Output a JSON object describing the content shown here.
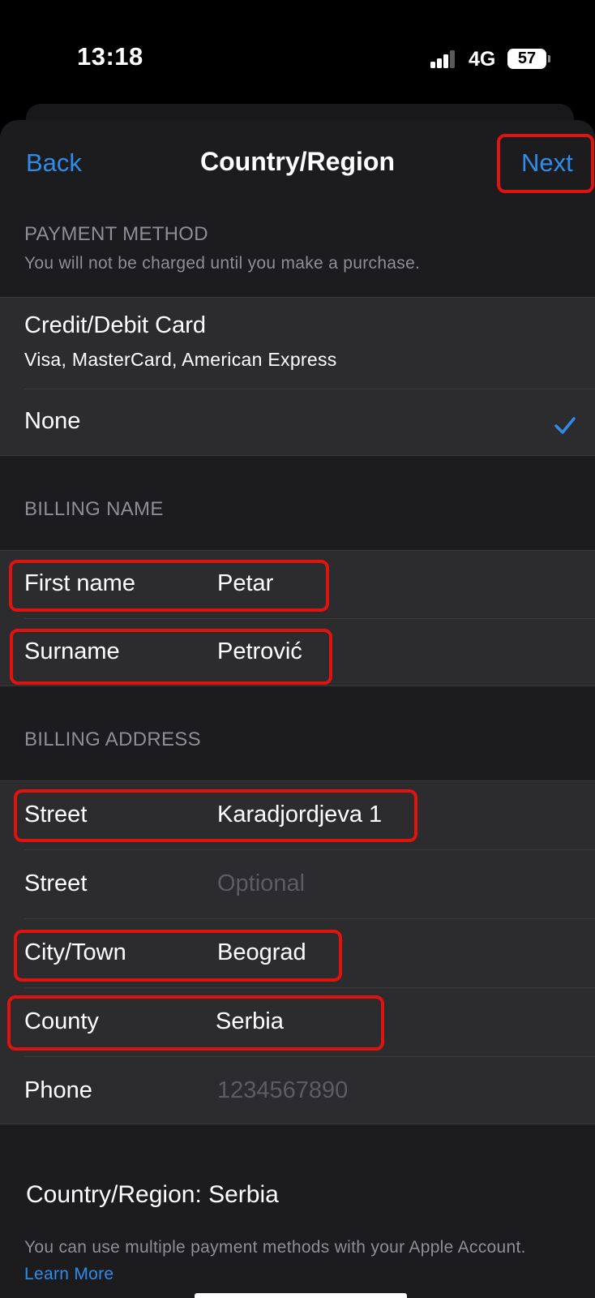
{
  "status_bar": {
    "time": "13:18",
    "network": "4G",
    "battery": "57",
    "icons": [
      "signal-icon",
      "battery-icon"
    ]
  },
  "nav": {
    "back_label": "Back",
    "title": "Country/Region",
    "next_label": "Next"
  },
  "payment": {
    "header": "PAYMENT METHOD",
    "subheader": "You will not be charged until you make a purchase.",
    "options": [
      {
        "label": "Credit/Debit Card",
        "sublabel": "Visa, MasterCard, American Express",
        "selected": false
      },
      {
        "label": "None",
        "selected": true
      }
    ]
  },
  "billing_name": {
    "header": "BILLING NAME",
    "fields": [
      {
        "label": "First name",
        "value": "Petar"
      },
      {
        "label": "Surname",
        "value": "Petrović"
      }
    ]
  },
  "billing_address": {
    "header": "BILLING ADDRESS",
    "fields": [
      {
        "label": "Street",
        "value": "Karadjordjeva 1"
      },
      {
        "label": "Street",
        "value": "",
        "placeholder": "Optional"
      },
      {
        "label": "City/Town",
        "value": "Beograd"
      },
      {
        "label": "County",
        "value": "Serbia"
      },
      {
        "label": "Phone",
        "value": "",
        "placeholder": "1234567890"
      }
    ]
  },
  "footer": {
    "country_line": "Country/Region: Serbia",
    "note": "You can use multiple payment methods with your Apple Account.",
    "learn_more": "Learn More"
  },
  "colors": {
    "accent": "#2f8dea",
    "highlight": "#e1130f",
    "sheet": "#1c1c1e",
    "cell": "#2c2c2e"
  }
}
